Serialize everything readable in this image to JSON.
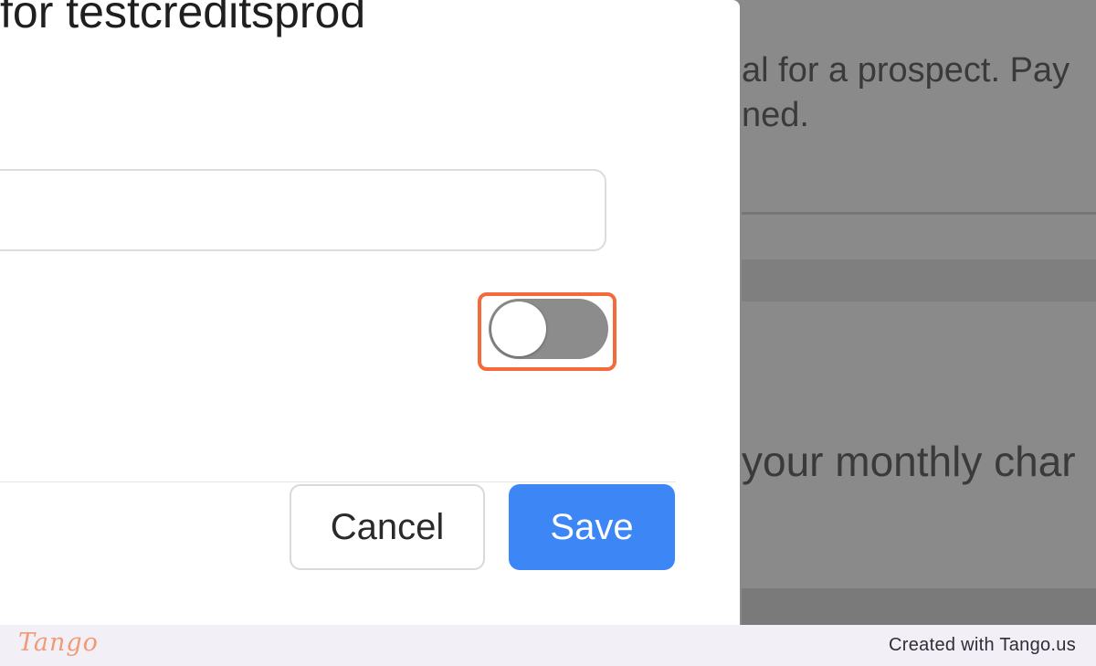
{
  "modal": {
    "title": "for testcreditsprod",
    "text_field_value": "",
    "toggle": {
      "state": "off",
      "track_color": "#8c8c8c",
      "highlight_color": "#f36b3b"
    },
    "cancel_label": "Cancel",
    "save_label": "Save",
    "save_color": "#3d86f6"
  },
  "background": {
    "line_1": "al for a prospect. Pay",
    "line_2": "ned.",
    "line_3": "your monthly char"
  },
  "footer": {
    "logo": "Tango",
    "credit": "Created with Tango.us",
    "logo_color": "#f19a76"
  }
}
